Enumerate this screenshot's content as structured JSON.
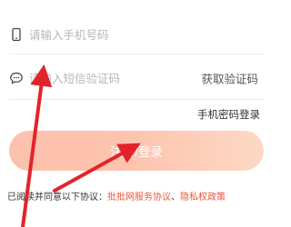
{
  "phone_input": {
    "placeholder": "请输入手机号码",
    "icon": "phone-icon"
  },
  "code_input": {
    "placeholder": "请输入短信验证码",
    "icon": "message-icon",
    "get_code_label": "获取验证码"
  },
  "password_login_label": "手机密码登录",
  "login_button_label": "注册/登录",
  "agreement": {
    "prefix": "已阅读并同意以下协议：",
    "service_link": "批批网服务协议",
    "separator": "、",
    "privacy_link": "隐私权政策"
  },
  "colors": {
    "accent_link": "#e8573f",
    "button_gradient_start": "#fbc1ad",
    "button_gradient_end": "#fdd8c4",
    "annotation_arrow": "#e3232b"
  }
}
